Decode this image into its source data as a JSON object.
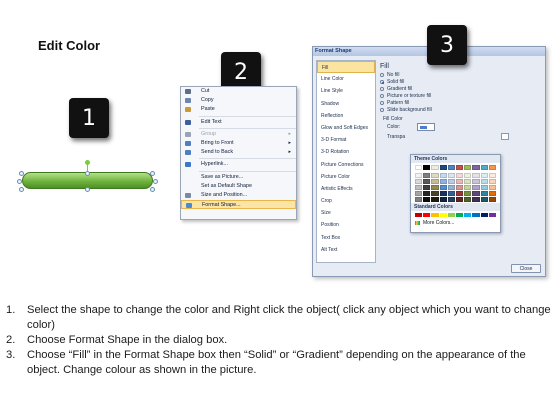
{
  "title": "Edit Color",
  "badges": [
    "1",
    "2",
    "3"
  ],
  "context_menu": {
    "items": [
      {
        "label": "Cut",
        "icon": "scissors-icon",
        "state": "normal"
      },
      {
        "label": "Copy",
        "icon": "copy-icon",
        "state": "normal"
      },
      {
        "label": "Paste",
        "icon": "paste-icon",
        "state": "normal"
      },
      {
        "label": "Edit Text",
        "icon": "edit-text-icon",
        "state": "normal"
      },
      {
        "label": "Group",
        "icon": "group-icon",
        "state": "disabled",
        "submenu": true
      },
      {
        "label": "Bring to Front",
        "icon": "bring-front-icon",
        "state": "normal",
        "submenu": true
      },
      {
        "label": "Send to Back",
        "icon": "send-back-icon",
        "state": "normal",
        "submenu": true
      },
      {
        "label": "Hyperlink...",
        "icon": "hyperlink-icon",
        "state": "normal"
      },
      {
        "label": "Save as Picture...",
        "icon": "",
        "state": "normal"
      },
      {
        "label": "Set as Default Shape",
        "icon": "",
        "state": "normal"
      },
      {
        "label": "Size and Position...",
        "icon": "size-icon",
        "state": "normal"
      },
      {
        "label": "Format Shape...",
        "icon": "format-shape-icon",
        "state": "selected"
      }
    ]
  },
  "dialog": {
    "title": "Format Shape",
    "nav": [
      "Fill",
      "Line Color",
      "Line Style",
      "Shadow",
      "Reflection",
      "Glow and Soft Edges",
      "3-D Format",
      "3-D Rotation",
      "Picture Corrections",
      "Picture Color",
      "Artistic Effects",
      "Crop",
      "Size",
      "Position",
      "Text Box",
      "Alt Text"
    ],
    "pane_heading": "Fill",
    "options": [
      {
        "label": "No fill",
        "checked": false
      },
      {
        "label": "Solid fill",
        "checked": true
      },
      {
        "label": "Gradient fill",
        "checked": false
      },
      {
        "label": "Picture or texture fill",
        "checked": false
      },
      {
        "label": "Pattern fill",
        "checked": false
      },
      {
        "label": "Slide background fill",
        "checked": false
      }
    ],
    "fill_color_heading": "Fill Color",
    "color_label": "Color:",
    "transparency_label": "Transpa",
    "close_label": "Close"
  },
  "palette": {
    "theme_heading": "Theme Colors",
    "theme_colors": [
      [
        "#ffffff",
        "#000000",
        "#eeece1",
        "#1f497d",
        "#4f81bd",
        "#c0504d",
        "#9bbb59",
        "#8064a2",
        "#4bacc6",
        "#f79646"
      ],
      [
        "#f2f2f2",
        "#7f7f7f",
        "#ddd9c3",
        "#c6d9f0",
        "#dbe5f1",
        "#f2dcdb",
        "#ebf1dd",
        "#e5e0ec",
        "#dbeef3",
        "#fdeada"
      ],
      [
        "#d8d8d8",
        "#595959",
        "#c4bd97",
        "#8db3e2",
        "#b8cce4",
        "#e5b9b7",
        "#d7e3bc",
        "#ccc1d9",
        "#b7dde8",
        "#fbd5b5"
      ],
      [
        "#bfbfbf",
        "#3f3f3f",
        "#938953",
        "#548dd4",
        "#95b3d7",
        "#d99694",
        "#c3d69b",
        "#b2a2c7",
        "#92cddc",
        "#fac08f"
      ],
      [
        "#a5a5a5",
        "#262626",
        "#494429",
        "#17365d",
        "#366092",
        "#953734",
        "#76923c",
        "#5f497a",
        "#31859b",
        "#e36c09"
      ],
      [
        "#7f7f7f",
        "#0c0c0c",
        "#1d1b10",
        "#0f243e",
        "#244061",
        "#632423",
        "#4f6128",
        "#3f3151",
        "#205867",
        "#974806"
      ]
    ],
    "standard_heading": "Standard Colors",
    "standard_colors": [
      "#c00000",
      "#ff0000",
      "#ffc000",
      "#ffff00",
      "#92d050",
      "#00b050",
      "#00b0f0",
      "#0070c0",
      "#002060",
      "#7030a0"
    ],
    "more_label": "More Colors..."
  },
  "shape": {
    "fill": "#6fb43c"
  },
  "steps": [
    {
      "num": "1.",
      "text": "Select the shape to change the color and Right click the object( click any object which you want to change color)"
    },
    {
      "num": "2.",
      "text": "Choose Format Shape in the dialog box."
    },
    {
      "num": "3.",
      "text": "Choose “Fill” in the Format Shape box then “Solid” or “Gradient” depending on the appearance of the object. Change colour as shown in the picture."
    }
  ]
}
